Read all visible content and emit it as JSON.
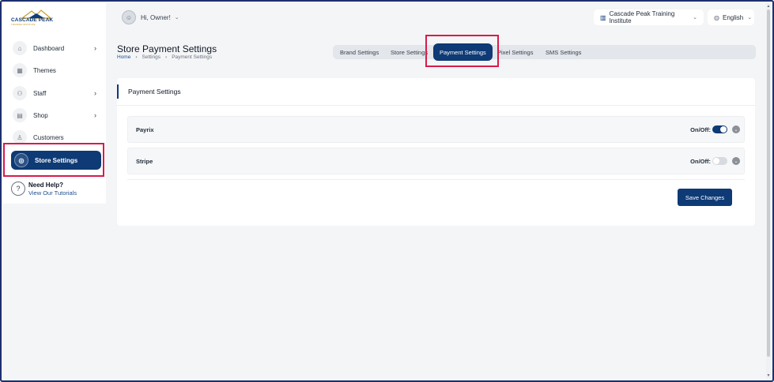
{
  "brand": {
    "name": "CASCADE PEAK",
    "tagline": "TRAINING INSTITUTE",
    "colors": {
      "primary": "#0e3a75",
      "highlight": "#d81b4a"
    }
  },
  "topbar": {
    "greeting": "Hi, Owner!",
    "institute": "Cascade Peak Training Institute",
    "language": "English"
  },
  "sidebar": {
    "items": [
      {
        "label": "Dashboard",
        "icon": "home-icon"
      },
      {
        "label": "Themes",
        "icon": "grid-icon"
      },
      {
        "label": "Staff",
        "icon": "users-icon"
      },
      {
        "label": "Shop",
        "icon": "store-icon"
      },
      {
        "label": "Customers",
        "icon": "user-icon"
      },
      {
        "label": "Store Settings",
        "icon": "settings-icon"
      }
    ],
    "help_title": "Need Help?",
    "help_link": "View Our Tutorials"
  },
  "page": {
    "title": "Store Payment Settings",
    "breadcrumb": [
      "Home",
      "Settings",
      "Payment Settings"
    ]
  },
  "tabs": [
    "Brand Settings",
    "Store Settings",
    "Payment Settings",
    "Pixel Settings",
    "SMS Settings"
  ],
  "card": {
    "title": "Payment Settings",
    "rows": [
      {
        "name": "Payrix",
        "onoff_label": "On/Off:",
        "enabled": true
      },
      {
        "name": "Stripe",
        "onoff_label": "On/Off:",
        "enabled": false
      }
    ],
    "save_label": "Save Changes"
  }
}
